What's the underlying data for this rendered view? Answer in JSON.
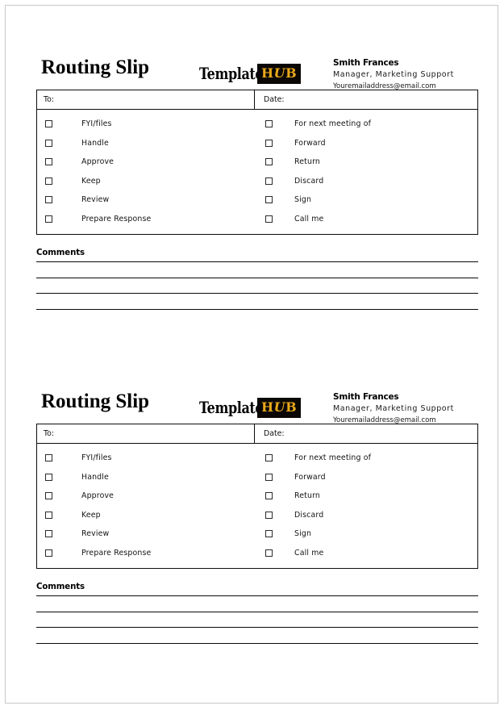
{
  "document": {
    "type": "routing-slip-template",
    "page_border_color": "#c8c8c8",
    "slip_count": 2
  },
  "brand": {
    "word": "Template",
    "badge_prefix": "H",
    "badge_italic": "U",
    "badge_suffix": "B",
    "badge_text": "HUB",
    "word_color": "#050505",
    "badge_bg": "#0a0705",
    "badge_color": "#e9a81b"
  },
  "contact": {
    "name": "Smith Frances",
    "role": "Manager,  Marketing  Support",
    "email": "Youremailaddress@email.com"
  },
  "slip": {
    "title": "Routing Slip",
    "table": {
      "head": {
        "to_label": "To:",
        "date_label": "Date:"
      },
      "left_options": [
        "FYI/files",
        "Handle",
        "Approve",
        "Keep",
        "Review",
        "Prepare Response"
      ],
      "right_options": [
        "For next meeting of",
        "Forward",
        "Return",
        "Discard",
        "Sign",
        "Call me"
      ]
    },
    "comments": {
      "title": "Comments",
      "line_count": 4
    }
  }
}
